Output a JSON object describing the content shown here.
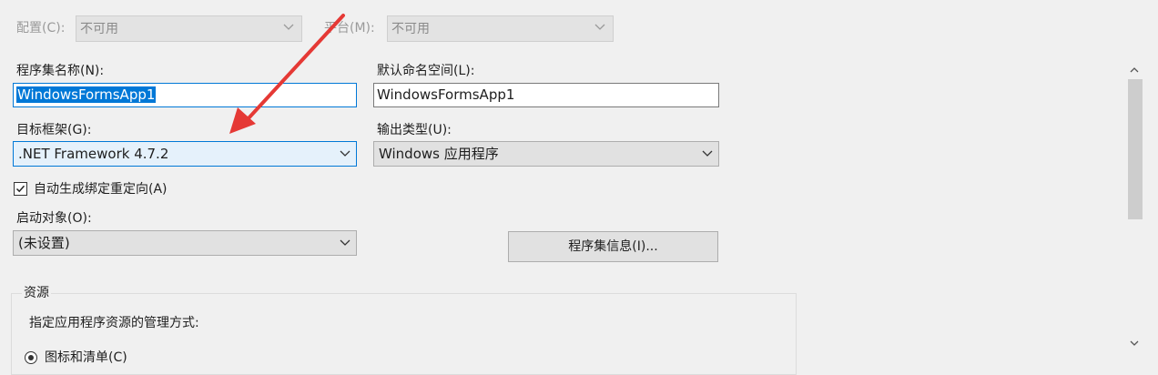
{
  "top": {
    "config_label": "配置(C):",
    "config_value": "不可用",
    "platform_label": "平台(M):",
    "platform_value": "不可用"
  },
  "assembly": {
    "name_label": "程序集名称(N):",
    "name_value": "WindowsFormsApp1",
    "namespace_label": "默认命名空间(L):",
    "namespace_value": "WindowsFormsApp1"
  },
  "framework": {
    "label": "目标框架(G):",
    "value": ".NET Framework 4.7.2"
  },
  "output": {
    "label": "输出类型(U):",
    "value": "Windows 应用程序"
  },
  "autobind": {
    "label": "自动生成绑定重定向(A)",
    "checked": true
  },
  "startup": {
    "label": "启动对象(O):",
    "value": "(未设置)"
  },
  "assembly_info_button": "程序集信息(I)...",
  "resources": {
    "title": "资源",
    "description": "指定应用程序资源的管理方式:",
    "option_partial": "图标和清单(C)"
  },
  "colors": {
    "selection": "#0078d7",
    "focus_border": "#0078d7",
    "annotation_arrow": "#e53935"
  },
  "icons": [
    "chevron-down-icon",
    "checkmark-icon",
    "scroll-up-icon",
    "scroll-down-icon",
    "annotation-arrow"
  ]
}
